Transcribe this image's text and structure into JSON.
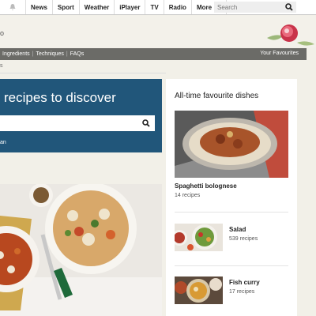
{
  "topnav": {
    "items": [
      "News",
      "Sport",
      "Weather",
      "iPlayer",
      "TV",
      "Radio",
      "More"
    ],
    "search_placeholder": "Search"
  },
  "logo_fragment": "o",
  "subnav": {
    "items": [
      "Ingredients",
      "Techniques",
      "FAQs"
    ],
    "favourites": "Your Favourites"
  },
  "breadcrumb": "s",
  "hero": {
    "title": "recipes to discover",
    "link": "an"
  },
  "panel": {
    "title": "All-time favourite dishes",
    "featured": {
      "name": "Spaghetti bolognese",
      "count": "14 recipes"
    },
    "items": [
      {
        "name": "Salad",
        "count": "539 recipes"
      },
      {
        "name": "Fish curry",
        "count": "17 recipes"
      }
    ]
  },
  "colors": {
    "hero": "#21567a",
    "subnav": "#6b6b67",
    "background": "#f2f0e8"
  }
}
